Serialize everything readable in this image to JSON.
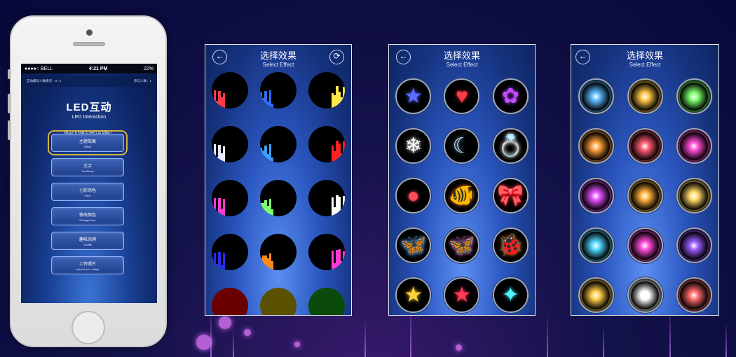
{
  "phone": {
    "status": {
      "carrier": "●●●●○ BELL",
      "time": "4:21 PM",
      "battery": "22%"
    },
    "info": {
      "left": "互动模块人数情况：0 / 1",
      "right": "参与人数：1"
    },
    "title": "LED互动",
    "subtitle": "LED Interaction",
    "question": "想与LED显示进行互动吗？",
    "question_en": "Would you like to interact with LED Monitor?",
    "menu": [
      {
        "zh": "主题效果",
        "en": "Effect",
        "active": true
      },
      {
        "zh": "文字",
        "en": "TextShow",
        "active": false
      },
      {
        "zh": "七彩涂色",
        "en": "Paint",
        "active": false
      },
      {
        "zh": "修改颜色",
        "en": "ChangeColor",
        "active": false
      },
      {
        "zh": "趣味涂鸦",
        "en": "Graffiti",
        "active": false
      },
      {
        "zh": "上传照片",
        "en": "Upload your image",
        "active": false
      }
    ]
  },
  "panels": [
    {
      "title": "选择效果",
      "subtitle": "Select Effect",
      "back_icon": "back-arrow-icon",
      "refresh_icon": "refresh-icon"
    },
    {
      "title": "选择效果",
      "subtitle": "Select Effect",
      "back_icon": "back-arrow-icon"
    },
    {
      "title": "选择效果",
      "subtitle": "Select Effect",
      "back_icon": "back-arrow-icon"
    }
  ],
  "effects_panel2": [
    {
      "icon": "star-icon",
      "glyph": "★",
      "color": "#5b6cff"
    },
    {
      "icon": "heart-icon",
      "glyph": "♥",
      "color": "#ff3a4a"
    },
    {
      "icon": "flower-icon",
      "glyph": "✿",
      "color": "#c04dff"
    },
    {
      "icon": "snowflake-icon",
      "glyph": "❄",
      "color": "#ffffff"
    },
    {
      "icon": "moon-icon",
      "glyph": "☾",
      "color": "#bfe2ff"
    },
    {
      "icon": "ring-icon",
      "glyph": "💍",
      "color": "#ffffff"
    },
    {
      "icon": "balloon-icon",
      "glyph": "●",
      "color": "#ff4b5c"
    },
    {
      "icon": "clownfish-icon",
      "glyph": "🐠",
      "color": "#ff7a1a"
    },
    {
      "icon": "bow-icon",
      "glyph": "🎀",
      "color": "#ff2b3a"
    },
    {
      "icon": "butterfly-blue-icon",
      "glyph": "🦋",
      "color": "#5fb6ff"
    },
    {
      "icon": "butterfly-pink-icon",
      "glyph": "🦋",
      "color": "#ff5ad9"
    },
    {
      "icon": "ladybug-icon",
      "glyph": "🐞",
      "color": "#ff8a1a"
    },
    {
      "icon": "gold-star-icon",
      "glyph": "★",
      "color": "#ffd23a"
    },
    {
      "icon": "red-star-icon",
      "glyph": "★",
      "color": "#ff3a58"
    },
    {
      "icon": "sparkle-icon",
      "glyph": "✦",
      "color": "#4df3ff"
    }
  ],
  "effects_panel3": [
    {
      "icon": "firework-blue-icon",
      "color": "#5ab8ff"
    },
    {
      "icon": "firework-gold-icon",
      "color": "#ffc548"
    },
    {
      "icon": "firework-green-icon",
      "color": "#7cff6a"
    },
    {
      "icon": "firework-orange-icon",
      "color": "#ff9f3a"
    },
    {
      "icon": "firework-red-icon",
      "color": "#ff5a70"
    },
    {
      "icon": "firework-multicolor-icon",
      "color": "#ff4ad2"
    },
    {
      "icon": "firework-magenta-icon",
      "color": "#e24dff"
    },
    {
      "icon": "firework-amber-icon",
      "color": "#ffb23a"
    },
    {
      "icon": "firework-yellow-icon",
      "color": "#ffd86a"
    },
    {
      "icon": "firework-cyan-icon",
      "color": "#4fd7ff"
    },
    {
      "icon": "firework-pink-icon",
      "color": "#ff4bd8"
    },
    {
      "icon": "firework-violet-icon",
      "color": "#9a5bff"
    },
    {
      "icon": "firework-rocket-icon",
      "color": "#ffcb4a"
    },
    {
      "icon": "firework-white-icon",
      "color": "#ffffff"
    },
    {
      "icon": "firework-red-white-icon",
      "color": "#ff6a6a"
    }
  ],
  "effects_panel1": [
    {
      "icon": "spectrum-red-icon",
      "color": "#ff3a4a"
    },
    {
      "icon": "spectrum-blue-icon",
      "color": "#2f6bff"
    },
    {
      "icon": "spectrum-yellow-icon",
      "color": "#ffe84a"
    },
    {
      "icon": "spectrum-white-icon",
      "color": "#e8e8ff"
    },
    {
      "icon": "spectrum-blue2-icon",
      "color": "#3aa0ff"
    },
    {
      "icon": "spectrum-red2-icon",
      "color": "#ff2222"
    },
    {
      "icon": "spectrum-magenta-icon",
      "color": "#ff3ad2"
    },
    {
      "icon": "spectrum-rainbow-icon",
      "color": "#7cff6a"
    },
    {
      "icon": "spectrum-white2-icon",
      "color": "#ffffff"
    },
    {
      "icon": "spectrum-navy-icon",
      "color": "#2a2aff"
    },
    {
      "icon": "spectrum-orange-icon",
      "color": "#ff8a1a"
    },
    {
      "icon": "spectrum-pink-icon",
      "color": "#ff3ad2"
    },
    {
      "icon": "spectrum-maroon-icon",
      "color": "#6a0000"
    },
    {
      "icon": "spectrum-olive-icon",
      "color": "#5a5200"
    },
    {
      "icon": "spectrum-green-icon",
      "color": "#0a4a0a"
    }
  ]
}
